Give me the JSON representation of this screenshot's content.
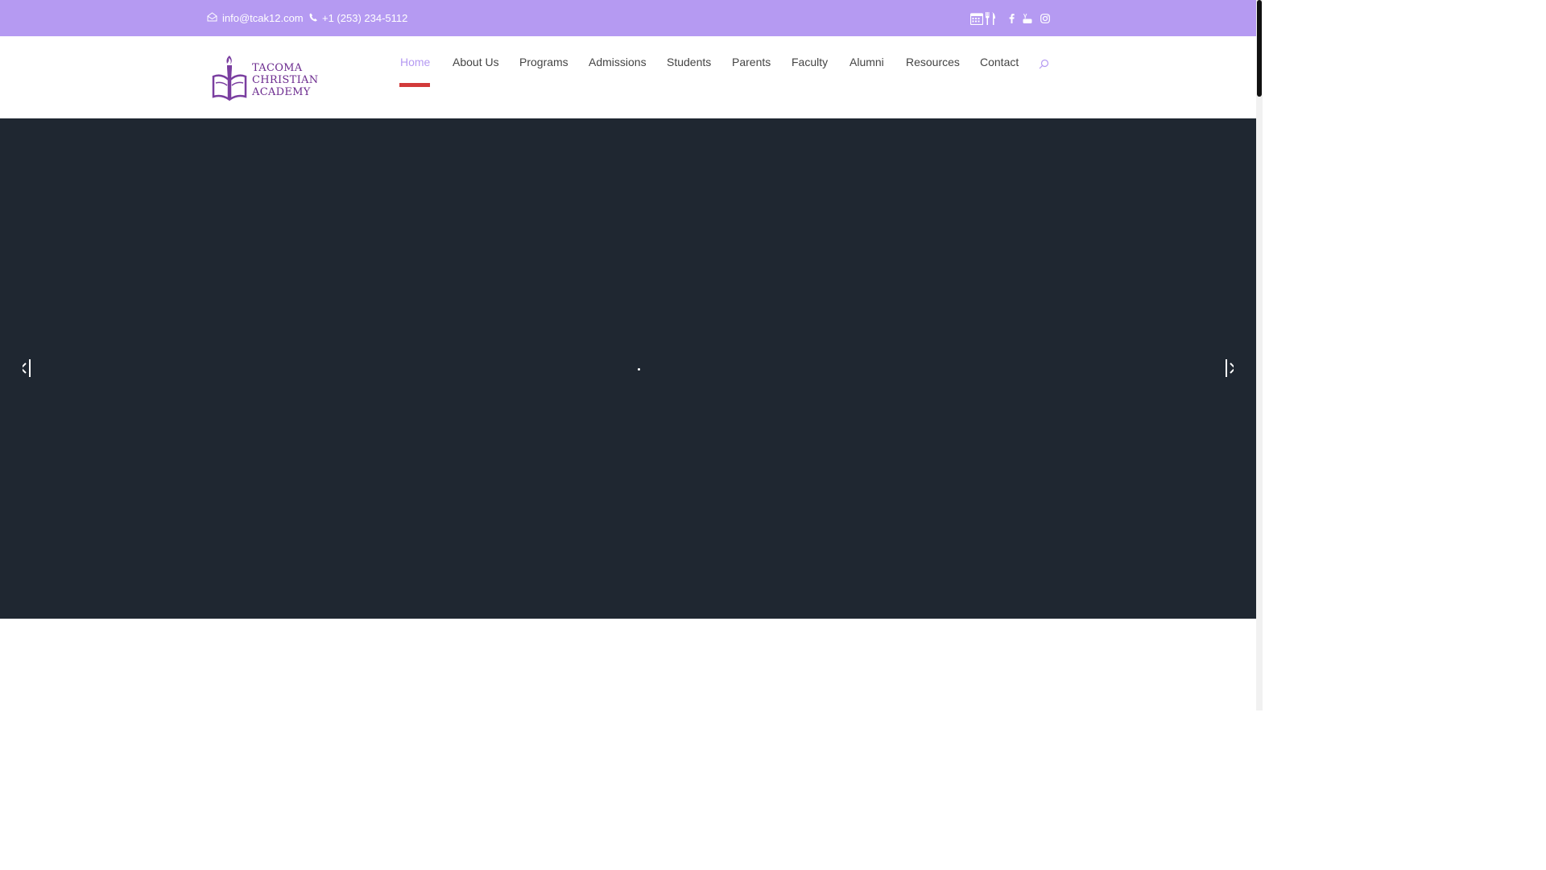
{
  "topbar": {
    "email": "info@tcak12.com",
    "phone": "+1 (253) 234-5112",
    "icons": [
      "envelope-icon",
      "phone-icon",
      "calendar-icon",
      "dining-icon",
      "facebook-icon",
      "youtube-icon",
      "instagram-icon"
    ]
  },
  "logo": {
    "line1": "TACOMA",
    "line2": "CHRISTIAN",
    "line3": "ACADEMY"
  },
  "nav": {
    "items": [
      {
        "label": "Home",
        "active": true
      },
      {
        "label": "About Us"
      },
      {
        "label": "Programs"
      },
      {
        "label": "Admissions"
      },
      {
        "label": "Students"
      },
      {
        "label": "Parents"
      },
      {
        "label": "Faculty"
      },
      {
        "label": "Alumni"
      },
      {
        "label": "Resources"
      },
      {
        "label": "Contact"
      }
    ]
  },
  "colors": {
    "topbar": "#b59af2",
    "active_nav": "#b59af2",
    "underline": "#d23a3a",
    "hero": "#1f2731",
    "logo": "#6b2a8e"
  }
}
